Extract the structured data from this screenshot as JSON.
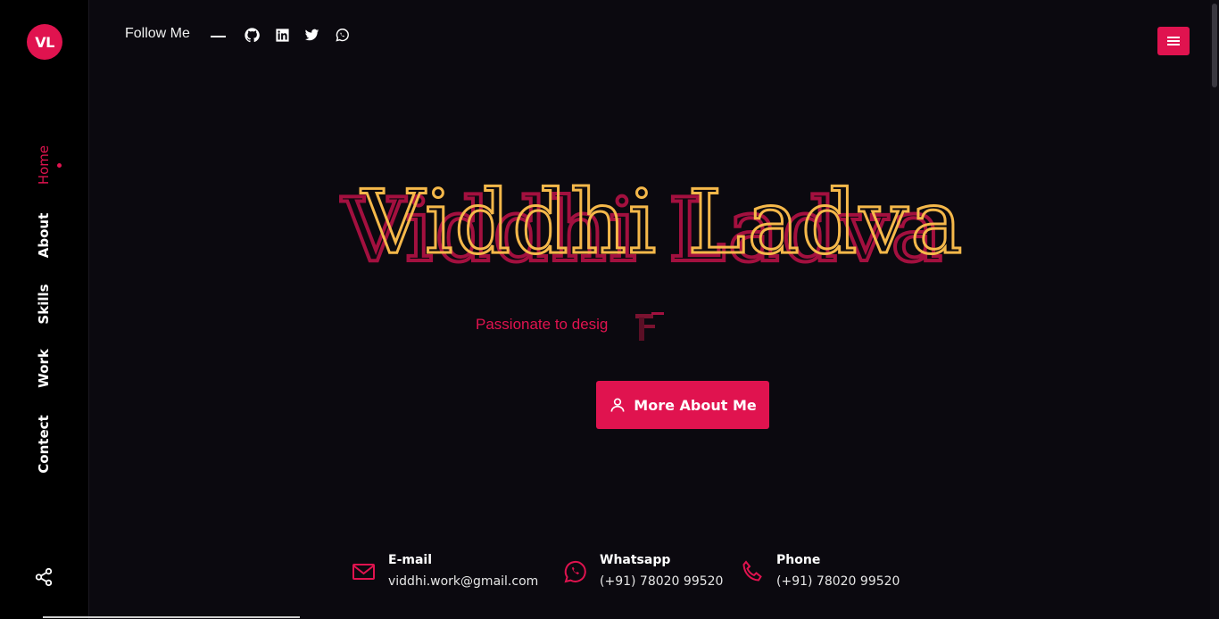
{
  "brand": {
    "initials": "VL"
  },
  "nav": {
    "items": [
      {
        "label": "Home",
        "active": true
      },
      {
        "label": "About",
        "active": false
      },
      {
        "label": "Skills",
        "active": false
      },
      {
        "label": "Work",
        "active": false
      },
      {
        "label": "Contect",
        "active": false
      }
    ]
  },
  "header": {
    "follow_label": "Follow Me",
    "social_icons": [
      "github-icon",
      "linkedin-icon",
      "twitter-icon",
      "whatsapp-icon"
    ]
  },
  "hero": {
    "name": "Viddhi Ladva",
    "tagline": "Passionate to desig",
    "cta_label": "More About Me"
  },
  "contacts": [
    {
      "label": "E-mail",
      "value": "viddhi.work@gmail.com",
      "icon": "mail-icon"
    },
    {
      "label": "Whatsapp",
      "value": "(+91) 78020 99520",
      "icon": "whatsapp-icon"
    },
    {
      "label": "Phone",
      "value": "(+91) 78020 99520",
      "icon": "phone-icon"
    }
  ],
  "colors": {
    "accent": "#e0134f",
    "background": "#0b090f",
    "sidebar": "#000000",
    "name_outline": "#f5b84a",
    "name_shadow": "#a3103f"
  }
}
